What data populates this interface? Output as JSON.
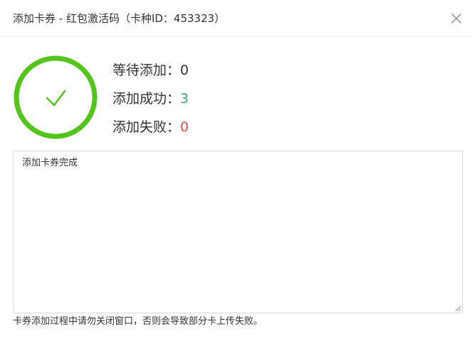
{
  "dialog": {
    "title": "添加卡券 - 红包激活码（卡种ID：453323）",
    "close_icon": "close-icon"
  },
  "status": {
    "icon": "checkmark-circle-icon",
    "ring_color": "#52c41a",
    "check_color": "#52c41a"
  },
  "stats": {
    "pending_label": "等待添加：",
    "pending_value": "0",
    "success_label": "添加成功：",
    "success_value": "3",
    "failed_label": "添加失败：",
    "failed_value": "0",
    "success_color": "#3aaa72",
    "failed_color": "#e5484d"
  },
  "log": {
    "text": "添加卡券完成"
  },
  "hint": {
    "text": "卡券添加过程中请勿关闭窗口，否则会导致部分卡上传失败。"
  }
}
